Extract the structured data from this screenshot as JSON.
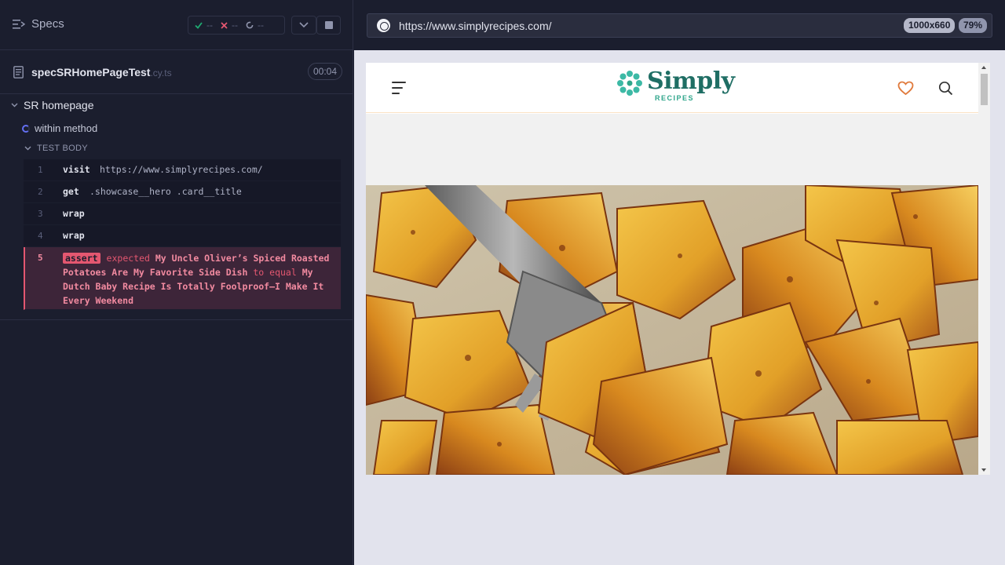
{
  "reporter": {
    "specs_label": "Specs",
    "stats": {
      "passed": "--",
      "failed": "--",
      "pending": "--"
    },
    "spec": {
      "name": "specSRHomePageTest",
      "ext": ".cy.ts",
      "duration": "00:04"
    },
    "suite": "SR homepage",
    "test": "within method",
    "body_header": "TEST BODY",
    "commands": [
      {
        "num": "1",
        "name": "visit",
        "arg": "https://www.simplyrecipes.com/"
      },
      {
        "num": "2",
        "name": "get",
        "arg": ".showcase__hero .card__title"
      },
      {
        "num": "3",
        "name": "wrap",
        "arg": ""
      },
      {
        "num": "4",
        "name": "wrap",
        "arg": ""
      }
    ],
    "failed_command": {
      "num": "5",
      "name": "assert",
      "kw_expected": "expected",
      "actual": "My Uncle Oliver’s Spiced Roasted Potatoes Are My Favorite Side Dish",
      "kw_to": "to",
      "kw_equal": "equal",
      "expected": "My Dutch Baby Recipe Is Totally Foolproof—I Make It Every Weekend"
    }
  },
  "browser": {
    "url": "https://www.simplyrecipes.com/",
    "viewport": "1000x660",
    "zoom": "79%"
  },
  "site": {
    "logo_main": "Simply",
    "logo_sub": "RECIPES"
  },
  "colors": {
    "reporter_bg": "#1b1e2e",
    "fail_bg": "#3d2539",
    "fail_accent": "#e45770",
    "logo_teal": "#1f6e64",
    "heart_orange": "#e07a3c"
  }
}
